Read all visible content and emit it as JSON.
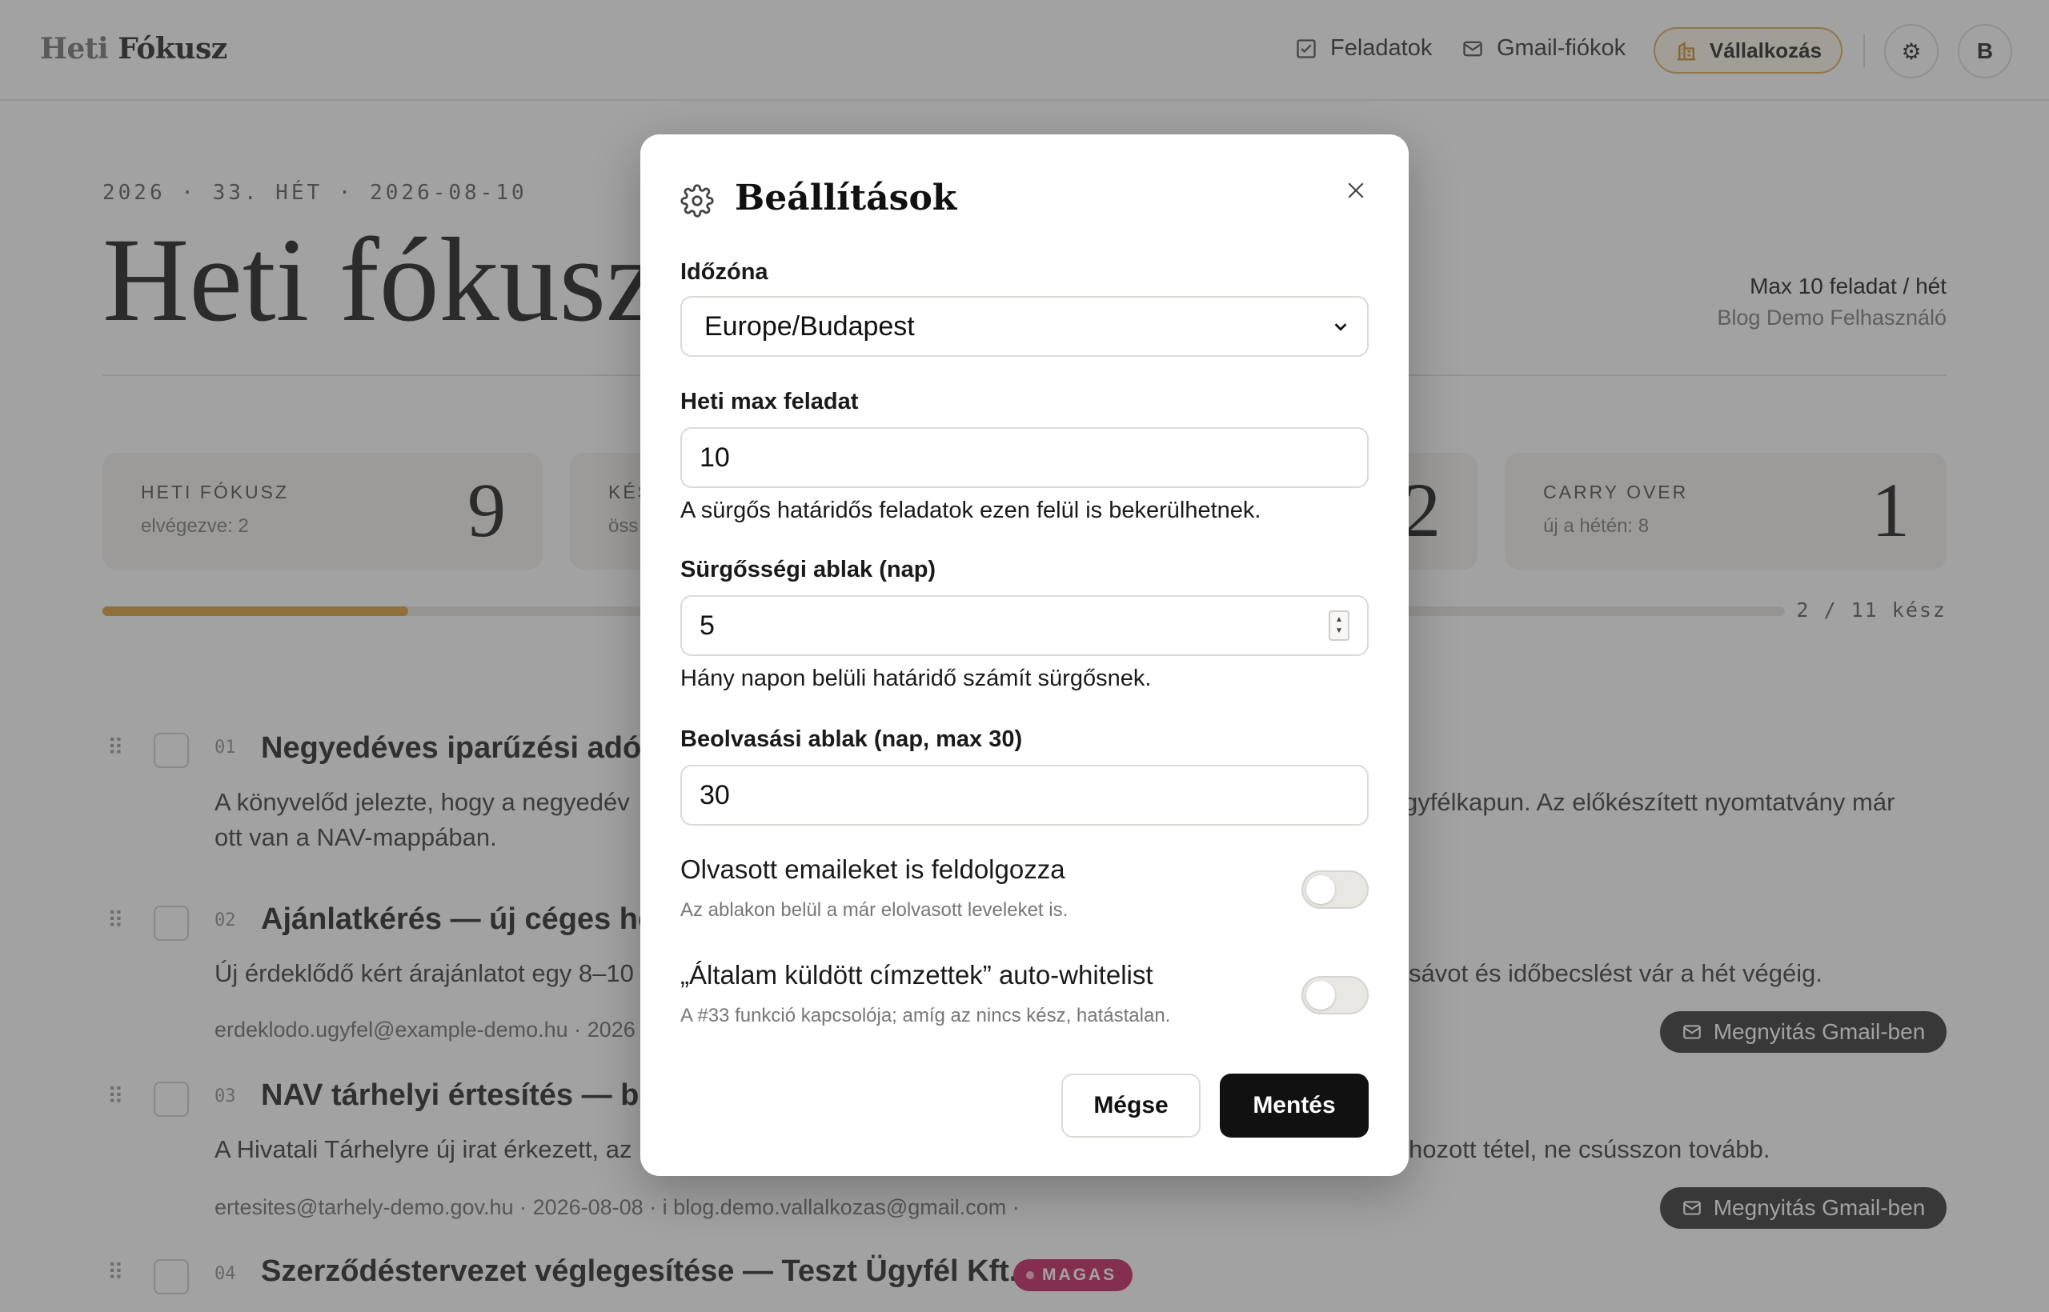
{
  "header": {
    "brand_part1": "Heti ",
    "brand_part2": "Fókusz",
    "nav": [
      {
        "label": "Feladatok",
        "icon": "checkbox-icon"
      },
      {
        "label": "Gmail-fiókok",
        "icon": "mail-icon"
      }
    ],
    "business_label": "Vállalkozás",
    "settings_icon": "⚙",
    "avatar_initial": "B"
  },
  "page": {
    "week_line": "2026 · 33. HÉT · 2026-08-10",
    "title": "Heti fókusz",
    "limit": "Max 10 feladat / hét",
    "user": "Blog Demo Felhasználó"
  },
  "stats": [
    {
      "label": "HETI FÓKUSZ",
      "sub": "elvégezve: 2",
      "value": "9"
    },
    {
      "label": "KÉS",
      "sub": "öss",
      "value": ""
    },
    {
      "label": "",
      "sub": "",
      "value": "2"
    },
    {
      "label": "CARRY OVER",
      "sub": "új a hétén: 8",
      "value": "1"
    }
  ],
  "progress": {
    "done": 2,
    "total": 11,
    "label": "2 / 11 kész",
    "accent": "#d99a2b"
  },
  "tasks": [
    {
      "num": "01",
      "title": "Negyedéves iparűzési adó b",
      "desc_left": "A könyvelőd jelezte, hogy a negyedév",
      "desc_right": "gyfélkapun. Az előkészített nyomtatvány már",
      "desc_line2": "ott van a NAV-mappában."
    },
    {
      "num": "02",
      "title": "Ajánlatkérés — új céges hon",
      "desc_left": "Új érdeklődő kért árajánlatot egy 8–10",
      "desc_right": "sávot és időbecslést vár a hét végéig.",
      "meta": "erdeklodo.ugyfel@example-demo.hu · 2026",
      "gmail": "Megnyitás Gmail-ben"
    },
    {
      "num": "03",
      "title": "NAV tárhelyi értesítés — be",
      "desc_left": "A Hivatali Tárhelyre új irat érkezett, az",
      "desc_right": "hozott tétel, ne csússzon tovább.",
      "meta": "ertesites@tarhely-demo.gov.hu · 2026-08-08 · i blog.demo.vallalkozas@gmail.com ·",
      "gmail": "Megnyitás Gmail-ben"
    },
    {
      "num": "04",
      "title": "Szerződéstervezet véglegesítése — Teszt Ügyfél Kft.",
      "badge": "MAGAS",
      "badge_color": "#c2185b"
    }
  ],
  "modal": {
    "title": "Beállítások",
    "timezone_label": "Időzóna",
    "timezone_value": "Europe/Budapest",
    "max_label": "Heti max feladat",
    "max_value": "10",
    "max_help": "A sürgős határidős feladatok ezen felül is bekerülhetnek.",
    "urgency_label": "Sürgősségi ablak (nap)",
    "urgency_value": "5",
    "urgency_help": "Hány napon belüli határidő számít sürgősnek.",
    "scan_label": "Beolvasási ablak (nap, max 30)",
    "scan_value": "30",
    "read_toggle_label": "Olvasott emaileket is feldolgozza",
    "read_toggle_help": "Az ablakon belül a már elolvasott leveleket is.",
    "read_toggle_on": false,
    "whitelist_label": "„Általam küldött címzettek” auto-whitelist",
    "whitelist_help": "A #33 funkció kapcsolója; amíg az nincs kész, hatástalan.",
    "whitelist_on": false,
    "cancel_label": "Mégse",
    "save_label": "Mentés"
  }
}
